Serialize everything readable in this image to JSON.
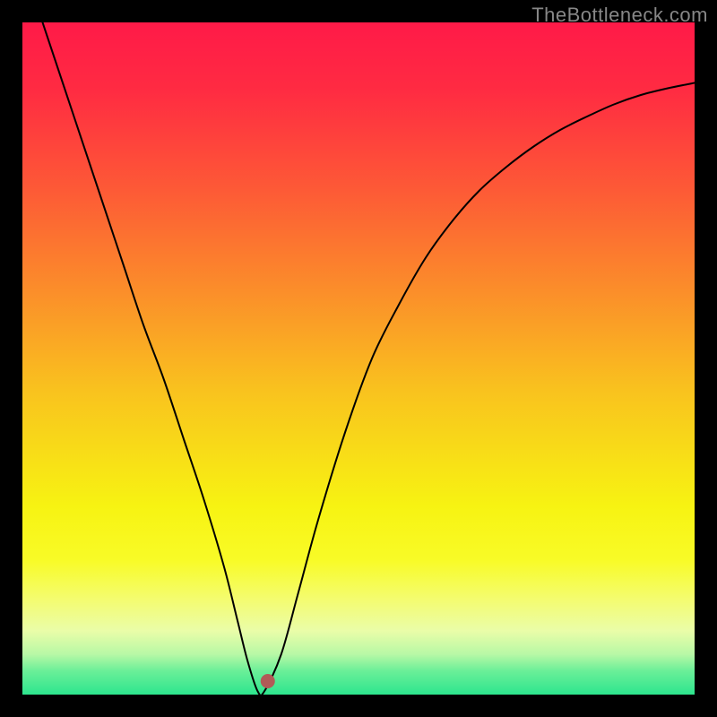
{
  "watermark": "TheBottleneck.com",
  "frame": {
    "outer_width": 800,
    "outer_height": 800,
    "border_color": "#000000",
    "border_width": 25
  },
  "gradient_stops": [
    {
      "offset": 0.0,
      "color": "#ff1a48"
    },
    {
      "offset": 0.1,
      "color": "#ff2b42"
    },
    {
      "offset": 0.25,
      "color": "#fd5a36"
    },
    {
      "offset": 0.4,
      "color": "#fb8e2a"
    },
    {
      "offset": 0.55,
      "color": "#f9c31e"
    },
    {
      "offset": 0.72,
      "color": "#f7f312"
    },
    {
      "offset": 0.8,
      "color": "#f8fb27"
    },
    {
      "offset": 0.86,
      "color": "#f4fc72"
    },
    {
      "offset": 0.905,
      "color": "#eafda8"
    },
    {
      "offset": 0.94,
      "color": "#b8f8a6"
    },
    {
      "offset": 0.965,
      "color": "#6aef98"
    },
    {
      "offset": 1.0,
      "color": "#2de58e"
    }
  ],
  "chart_data": {
    "type": "line",
    "title": "",
    "xlabel": "",
    "ylabel": "",
    "xlim": [
      0,
      100
    ],
    "ylim": [
      0,
      100
    ],
    "notch": {
      "x": 35,
      "y": 0
    },
    "marker": {
      "x": 36.5,
      "y": 2,
      "color": "#b15b57",
      "radius": 8
    },
    "series": [
      {
        "name": "curve",
        "color": "#000000",
        "stroke_width": 2,
        "x": [
          3,
          6,
          9,
          12,
          15,
          18,
          21,
          24,
          27,
          30,
          32,
          33.5,
          35,
          36,
          38.5,
          41,
          44,
          48,
          52,
          56,
          60,
          64,
          68,
          72,
          76,
          80,
          84,
          88,
          92,
          96,
          100
        ],
        "y": [
          100,
          91,
          82,
          73,
          64,
          55,
          47,
          38,
          29,
          19,
          11,
          5,
          0.5,
          0.5,
          6,
          15,
          26,
          39,
          50,
          58,
          65,
          70.5,
          75,
          78.5,
          81.5,
          84,
          86,
          87.8,
          89.2,
          90.2,
          91
        ]
      }
    ]
  }
}
